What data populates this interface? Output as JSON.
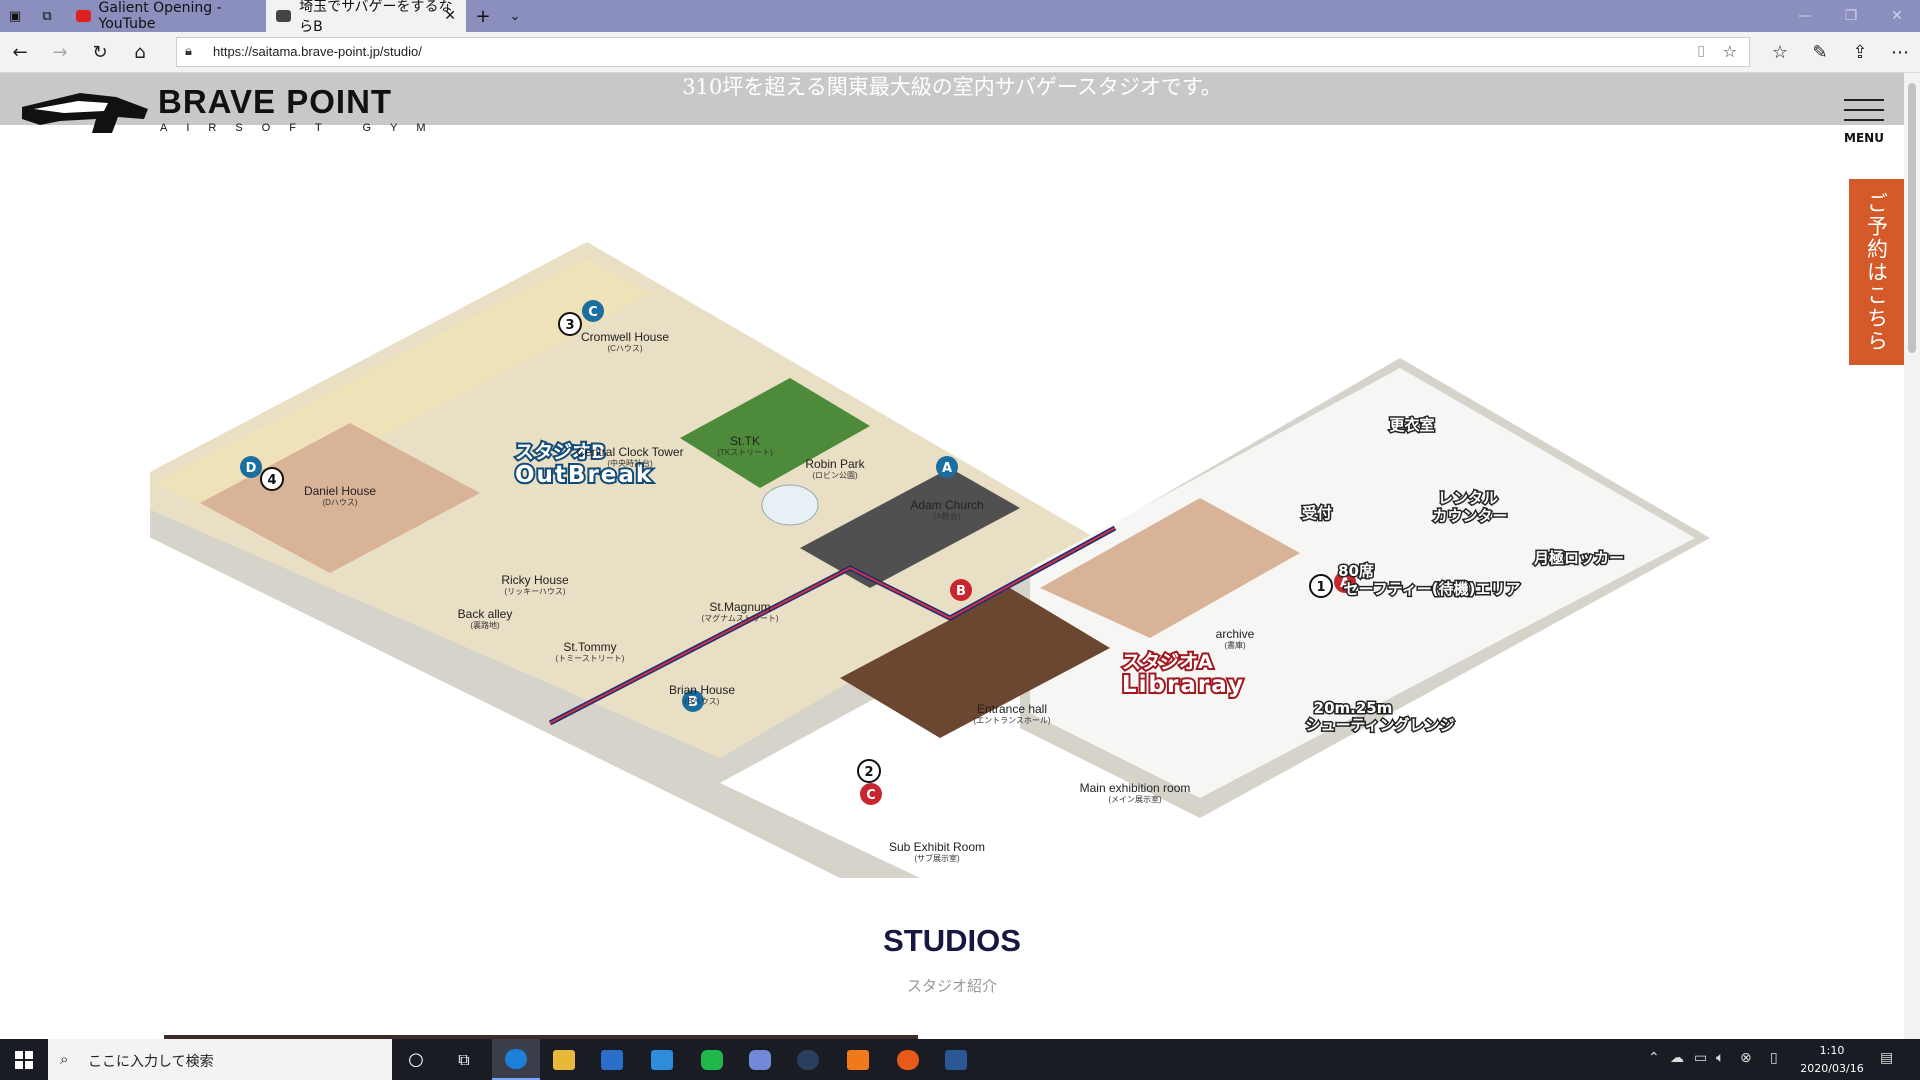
{
  "browser": {
    "tabs": [
      {
        "title": "Galient Opening - YouTube",
        "active": false
      },
      {
        "title": "埼玉でサバゲーをするならB",
        "active": true
      }
    ],
    "url": "https://saitama.brave-point.jp/studio/"
  },
  "site": {
    "tagline": "310坪を超える関東最大級の室内サバゲースタジオです。",
    "logo_name": "BRAVE POINT",
    "logo_sub": "AIRSOFT GYM",
    "menu_label": "MENU",
    "reserve_label": "ご予約はこちら"
  },
  "map": {
    "studio_b": {
      "line1": "スタジオB",
      "line2": "OutBreak"
    },
    "studio_a": {
      "line1": "スタジオA",
      "line2": "Libraray"
    },
    "locations": [
      {
        "name": "Cromwell House",
        "sub": "(Cハウス)"
      },
      {
        "name": "Central Clock Tower",
        "sub": "(中央時計台)"
      },
      {
        "name": "St.TK",
        "sub": "(TKストリート)"
      },
      {
        "name": "Robin Park",
        "sub": "(ロビン公園)"
      },
      {
        "name": "Adam Church",
        "sub": "(A教会)"
      },
      {
        "name": "Daniel House",
        "sub": "(Dハウス)"
      },
      {
        "name": "Ricky House",
        "sub": "(リッキーハウス)"
      },
      {
        "name": "Back alley",
        "sub": "(裏路地)"
      },
      {
        "name": "St.Tommy",
        "sub": "(トミーストリート)"
      },
      {
        "name": "St.Magnum",
        "sub": "(マグナムストリート)"
      },
      {
        "name": "Brian House",
        "sub": "(Bハウス)"
      },
      {
        "name": "Entrance hall",
        "sub": "(エントランスホール)"
      },
      {
        "name": "archive",
        "sub": "(書庫)"
      },
      {
        "name": "Main exhibition room",
        "sub": "(メイン展示室)"
      },
      {
        "name": "Sub Exhibit Room",
        "sub": "(サブ展示室)"
      }
    ],
    "facilities": {
      "changing_room": "更衣室",
      "reception": "受付",
      "rental_1": "レンタル",
      "rental_2": "カウンター",
      "locker": "月極ロッカー",
      "safety_1": "80席",
      "safety_2": "セーフティー(待機)エリア",
      "range_1": "20m.25m",
      "range_2": "シューティングレンジ"
    },
    "markers": {
      "c": "C",
      "three": "3",
      "d": "D",
      "four": "4",
      "a": "A",
      "b": "B",
      "b2": "B",
      "one": "1",
      "a2": "A",
      "two": "2",
      "c2": "C"
    }
  },
  "section": {
    "title": "STUDIOS",
    "subtitle": "スタジオ紹介"
  },
  "taskbar": {
    "search_placeholder": "ここに入力して検索",
    "time": "1:10",
    "date": "2020/03/16"
  }
}
